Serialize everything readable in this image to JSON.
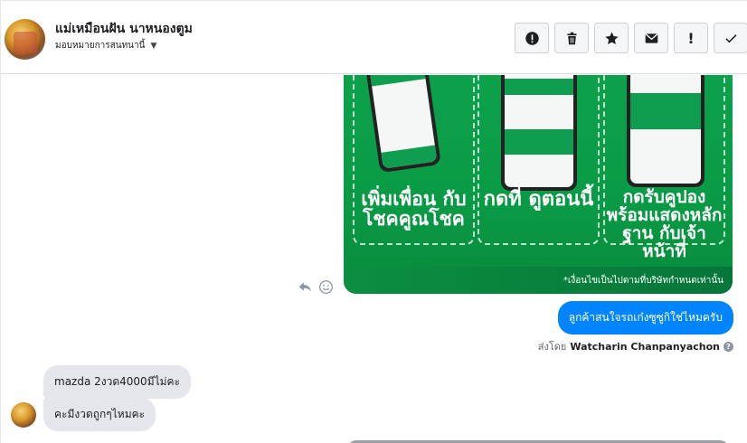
{
  "header": {
    "contact_name": "แม่เหมือนฝัน นาหนองตูม",
    "assign_label": "มอบหมายการสนทนานี้",
    "actions": [
      "alert-circle-icon",
      "trash-icon",
      "star-icon",
      "envelope-icon",
      "exclamation-icon",
      "checkmark-icon"
    ]
  },
  "promo": {
    "captions": [
      "เพิ่มเพื่อน กับโชคคูณโชค",
      "กดที่ ดูตอนนี้",
      "กดรับคูปอง พร้อมแสดงหลักฐาน กับเจ้าหน้าที่"
    ],
    "footnote": "*เงื่อนไขเป็นไปตามที่บริษัทกำหนดเท่านั้น"
  },
  "messages": {
    "outgoing": [
      "ลูกค้าสนใจรถเก๋งซูซูกิใช่ไหมครับ"
    ],
    "sent_by_prefix": "ส่งโดย",
    "sent_by_name": "Watcharin Chanpanyachon",
    "incoming": [
      "mazda 2งวด4000มีไม่คะ",
      "คะมีงวดถูกๆไหมคะ"
    ]
  },
  "colors": {
    "outgoing_bubble": "#0084ff",
    "incoming_bubble": "#e4e6eb",
    "promo_green": "#0da14b"
  }
}
